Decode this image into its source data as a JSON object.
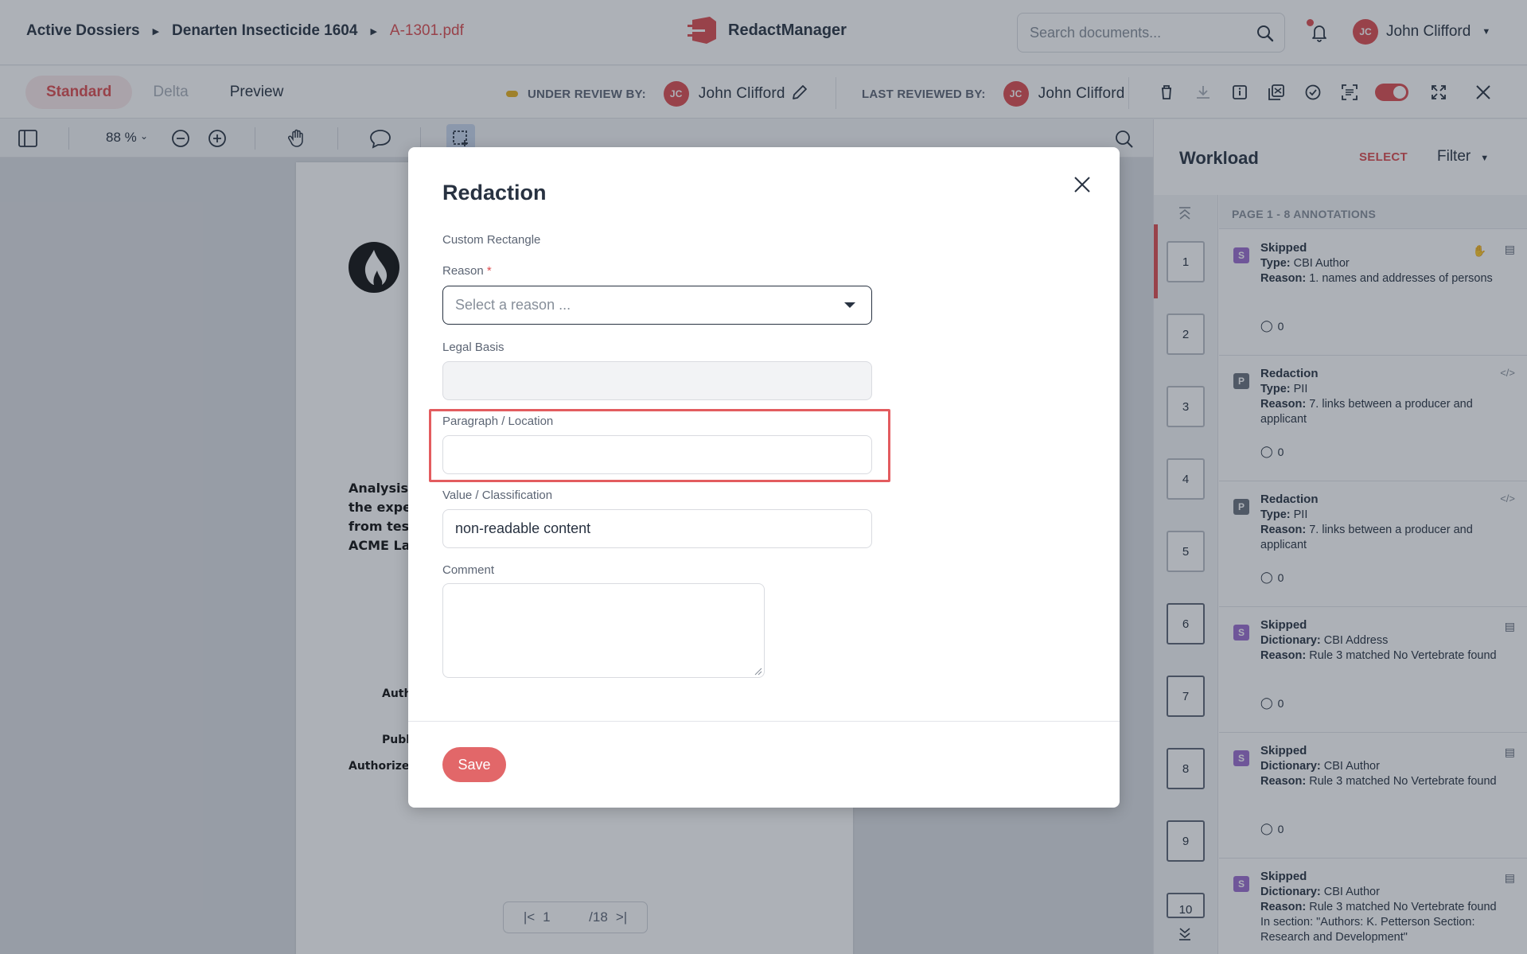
{
  "header": {
    "breadcrumbs": [
      "Active Dossiers",
      "Denarten Insecticide 1604",
      "A-1301.pdf"
    ],
    "brand": "RedactManager",
    "search_placeholder": "Search documents...",
    "user_initials": "JC",
    "user_name": "John Clifford"
  },
  "toolbar": {
    "tabs": [
      "Standard",
      "Delta",
      "Preview"
    ],
    "under_review_label": "UNDER REVIEW BY:",
    "under_review_initials": "JC",
    "under_review_name": "John Clifford",
    "last_reviewed_label": "LAST REVIEWED BY:",
    "last_reviewed_initials": "JC",
    "last_reviewed_name": "John Clifford",
    "status_color": "#e8b21e",
    "icons": [
      "delete-icon",
      "download-icon",
      "info-icon",
      "compare-icon",
      "approve-icon",
      "ocr-icon",
      "toggle",
      "fullscreen-icon",
      "close-icon"
    ]
  },
  "viewer": {
    "zoom": "88 %",
    "pdf_text_lines": [
      "Analysis",
      "the exper",
      "from test",
      "ACME Lal"
    ],
    "pdf_labels": [
      "Auth",
      "Publ",
      "Authorized"
    ],
    "page_current": "1",
    "page_total": "/18"
  },
  "panel": {
    "title": "Workload",
    "select_label": "SELECT",
    "filter_label": "Filter",
    "annotations_header": "PAGE 1 - 8 ANNOTATIONS",
    "pages": [
      "1",
      "2",
      "3",
      "4",
      "5",
      "6",
      "7",
      "8",
      "9",
      "10"
    ],
    "annotations": [
      {
        "badge": "S",
        "title": "Skipped",
        "k1": "Type:",
        "v1": " CBI Author",
        "k2": "Reason:",
        "v2": " 1. names and addresses of persons",
        "comments": "0"
      },
      {
        "badge": "P",
        "title": "Redaction",
        "k1": "Type:",
        "v1": " PII",
        "k2": "Reason:",
        "v2": " 7. links between a producer and applicant",
        "comments": "0"
      },
      {
        "badge": "P",
        "title": "Redaction",
        "k1": "Type:",
        "v1": " PII",
        "k2": "Reason:",
        "v2": " 7. links between a producer and applicant",
        "comments": "0"
      },
      {
        "badge": "S",
        "title": "Skipped",
        "k1": "Dictionary:",
        "v1": " CBI Address",
        "k2": "Reason:",
        "v2": " Rule 3 matched No Vertebrate found",
        "comments": "0"
      },
      {
        "badge": "S",
        "title": "Skipped",
        "k1": "Dictionary:",
        "v1": " CBI Author",
        "k2": "Reason:",
        "v2": " Rule 3 matched No Vertebrate found",
        "comments": "0"
      },
      {
        "badge": "S",
        "title": "Skipped",
        "k1": "Dictionary:",
        "v1": " CBI Author",
        "k2": "Reason:",
        "v2": " Rule 3 matched No Vertebrate found In section: \"Authors: K. Petterson Section: Research and Development\"",
        "comments": ""
      }
    ]
  },
  "modal": {
    "title": "Redaction",
    "subtitle": "Custom Rectangle",
    "reason_label": "Reason",
    "required_mark": "*",
    "reason_placeholder": "Select a reason ...",
    "legal_basis_label": "Legal Basis",
    "legal_basis_value": "",
    "paragraph_label": "Paragraph / Location",
    "paragraph_value": "",
    "value_label": "Value / Classification",
    "value_value": "non-readable content",
    "comment_label": "Comment",
    "save_label": "Save"
  }
}
